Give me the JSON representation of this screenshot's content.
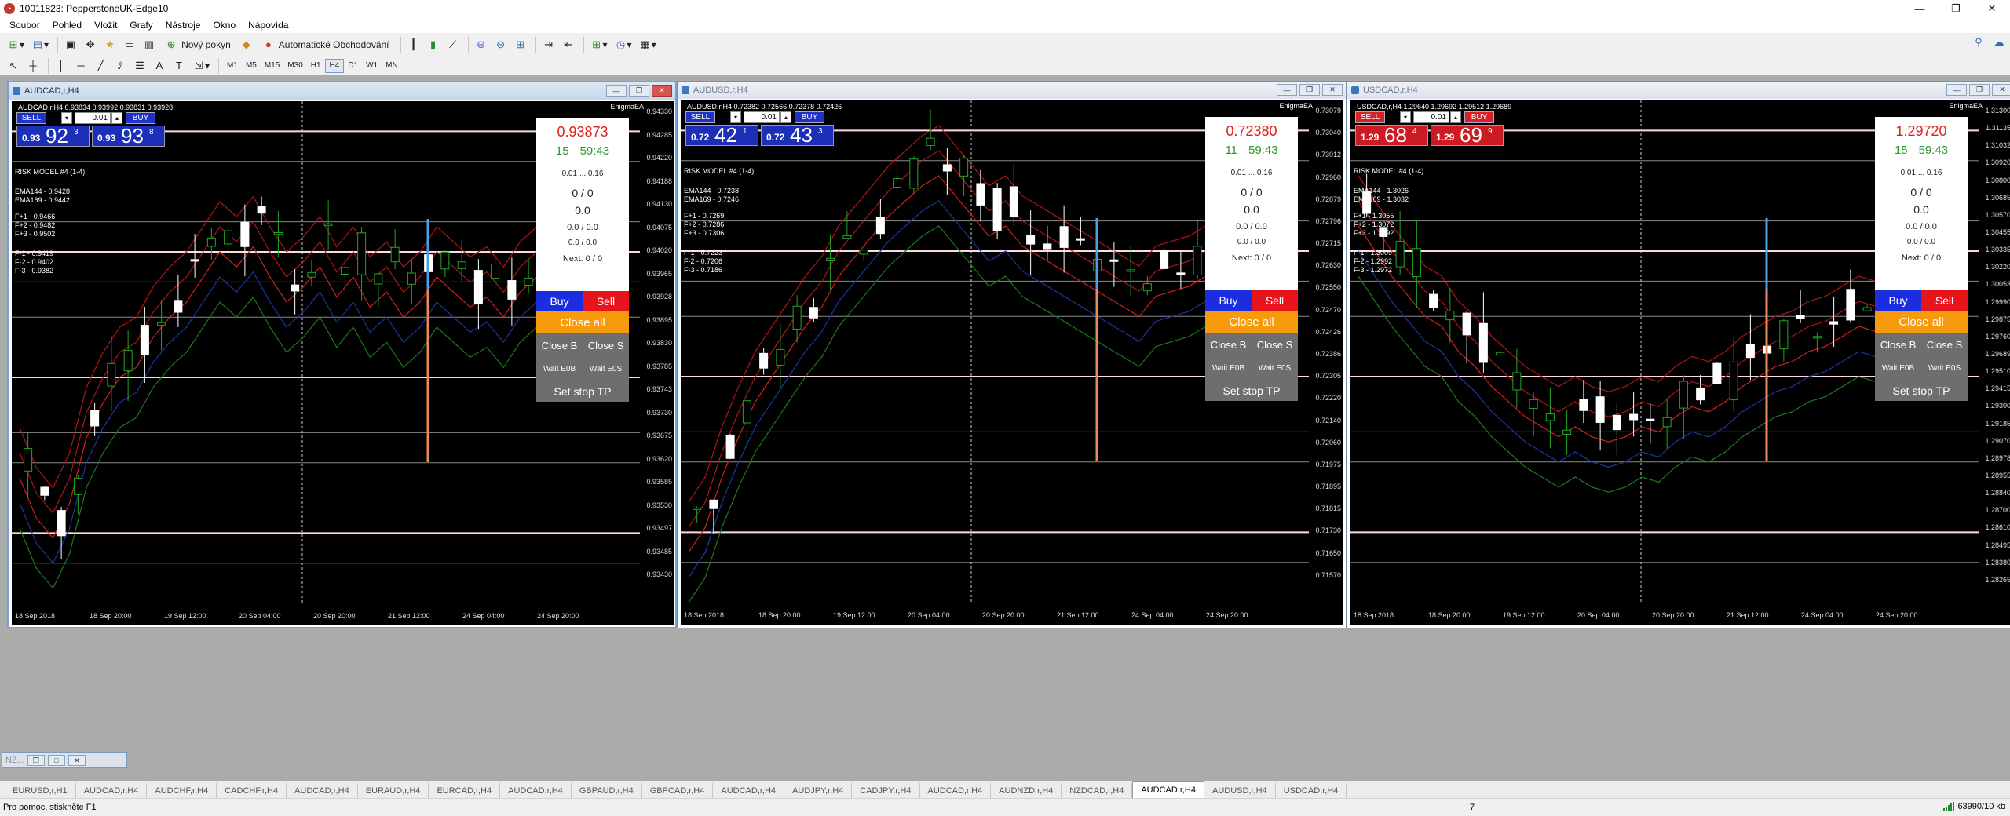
{
  "app": {
    "title": "10011823: PepperstoneUK-Edge10"
  },
  "menu": [
    "Soubor",
    "Pohled",
    "Vložit",
    "Grafy",
    "Nástroje",
    "Okno",
    "Nápovìda"
  ],
  "toolbar": {
    "new_order_label": "Nový pokyn",
    "autotrading_label": "Automatické Obchodování",
    "timeframes": [
      "M1",
      "M5",
      "M15",
      "M30",
      "H1",
      "H4",
      "D1",
      "W1",
      "MN"
    ],
    "active_timeframe": "H4"
  },
  "charts": [
    {
      "window_title": "AUDCAD,r,H4",
      "ohlc_line": "AUDCAD,r,H4  0.93834 0.93992 0.93831 0.93928",
      "ea_label": "EnigmaEA",
      "lot": "0.01",
      "sell_label": "SELL",
      "buy_label": "BUY",
      "sell_quote": {
        "small": "0.93",
        "big": "92",
        "sup": "3"
      },
      "buy_quote": {
        "small": "0.93",
        "big": "93",
        "sup": "8"
      },
      "theme": "blue",
      "risk_model": "RISK MODEL #4 (1-4)",
      "ema_lines": [
        "EMA144 - 0.9428",
        "EMA169 - 0.9442"
      ],
      "fplus_lines": [
        "F+1 - 0.9466",
        "F+2 - 0.9482",
        "F+3 - 0.9502"
      ],
      "fminus_lines": [
        "F-1 - 0.9419",
        "F-2 - 0.9402",
        "F-3 - 0.9382"
      ],
      "panel": {
        "price": "0.93873",
        "timer_a": "15",
        "timer_b": "59:43",
        "range": "0.01 ... 0.16",
        "r1": "0 / 0",
        "r2": "0.0",
        "r3": "0.0 / 0.0",
        "r4": "0.0 / 0.0",
        "next": "Next: 0 / 0"
      },
      "axis_labels": [
        "0.94330",
        "0.94285",
        "0.94220",
        "0.94188",
        "0.94130",
        "0.94075",
        "0.94020",
        "0.93965",
        "0.93928",
        "0.93895",
        "0.93830",
        "0.93785",
        "0.93743",
        "0.93730",
        "0.93675",
        "0.93620",
        "0.93585",
        "0.93530",
        "0.93497",
        "0.93485",
        "0.93430"
      ],
      "dates": [
        "18 Sep 2018",
        "18 Sep 20:00",
        "19 Sep 12:00",
        "20 Sep 04:00",
        "20 Sep 20:00",
        "21 Sep 12:00",
        "24 Sep 04:00",
        "24 Sep 20:00"
      ]
    },
    {
      "window_title": "AUDUSD,r,H4",
      "ohlc_line": "AUDUSD,r,H4  0.72382 0.72566 0.72378 0.72426",
      "ea_label": "EnigmaEA",
      "lot": "0.01",
      "sell_label": "SELL",
      "buy_label": "BUY",
      "sell_quote": {
        "small": "0.72",
        "big": "42",
        "sup": "1"
      },
      "buy_quote": {
        "small": "0.72",
        "big": "43",
        "sup": "3"
      },
      "theme": "blue",
      "risk_model": "RISK MODEL #4 (1-4)",
      "ema_lines": [
        "EMA144 - 0.7238",
        "EMA169 - 0.7246"
      ],
      "fplus_lines": [
        "F+1 - 0.7269",
        "F+2 - 0.7286",
        "F+3 - 0.7306"
      ],
      "fminus_lines": [
        "F-1 - 0.7223",
        "F-2 - 0.7206",
        "F-3 - 0.7186"
      ],
      "panel": {
        "price": "0.72380",
        "timer_a": "11",
        "timer_b": "59:43",
        "range": "0.01 ... 0.16",
        "r1": "0 / 0",
        "r2": "0.0",
        "r3": "0.0 / 0.0",
        "r4": "0.0 / 0.0",
        "next": "Next: 0 / 0"
      },
      "axis_labels": [
        "0.73079",
        "0.73040",
        "0.73012",
        "0.72960",
        "0.72879",
        "0.72796",
        "0.72715",
        "0.72630",
        "0.72550",
        "0.72470",
        "0.72426",
        "0.72386",
        "0.72305",
        "0.72220",
        "0.72140",
        "0.72060",
        "0.71975",
        "0.71895",
        "0.71815",
        "0.71730",
        "0.71650",
        "0.71570"
      ],
      "dates": [
        "18 Sep 2018",
        "18 Sep 20:00",
        "19 Sep 12:00",
        "20 Sep 04:00",
        "20 Sep 20:00",
        "21 Sep 12:00",
        "24 Sep 04:00",
        "24 Sep 20:00"
      ]
    },
    {
      "window_title": "USDCAD,r,H4",
      "ohlc_line": "USDCAD,r,H4  1.29640 1.29692 1.29512 1.29689",
      "ea_label": "EnigmaEA",
      "lot": "0.01",
      "sell_label": "SELL",
      "buy_label": "BUY",
      "sell_quote": {
        "small": "1.29",
        "big": "68",
        "sup": "4"
      },
      "buy_quote": {
        "small": "1.29",
        "big": "69",
        "sup": "9"
      },
      "theme": "red",
      "risk_model": "RISK MODEL #4 (1-4)",
      "ema_lines": [
        "EMA144 - 1.3026",
        "EMA169 - 1.3032"
      ],
      "fplus_lines": [
        "F+1 - 1.3055",
        "F+2 - 1.3072",
        "F+3 - 1.3092"
      ],
      "fminus_lines": [
        "F-1 - 1.3009",
        "F-2 - 1.2992",
        "F-3 - 1.2972"
      ],
      "panel": {
        "price": "1.29720",
        "timer_a": "15",
        "timer_b": "59:43",
        "range": "0.01 ... 0.16",
        "r1": "0 / 0",
        "r2": "0.0",
        "r3": "0.0 / 0.0",
        "r4": "0.0 / 0.0",
        "next": "Next: 0 / 0"
      },
      "axis_labels": [
        "1.31300",
        "1.31135",
        "1.31032",
        "1.30920",
        "1.30800",
        "1.30685",
        "1.30570",
        "1.30455",
        "1.30335",
        "1.30220",
        "1.30053",
        "1.29990",
        "1.29875",
        "1.29760",
        "1.29689",
        "1.29510",
        "1.29415",
        "1.29300",
        "1.29185",
        "1.29070",
        "1.28978",
        "1.28955",
        "1.28840",
        "1.28700",
        "1.28610",
        "1.28495",
        "1.28380",
        "1.28265"
      ],
      "dates": [
        "18 Sep 2018",
        "18 Sep 20:00",
        "19 Sep 12:00",
        "20 Sep 04:00",
        "20 Sep 20:00",
        "21 Sep 12:00",
        "24 Sep 04:00",
        "24 Sep 20:00"
      ]
    }
  ],
  "panel_buttons": {
    "buy": "Buy",
    "sell": "Sell",
    "close_all": "Close all",
    "close_b": "Close B",
    "close_s": "Close S",
    "wait_eob": "Wait E0B",
    "wait_eos": "Wait E0S",
    "set_stop": "Set stop TP"
  },
  "minimized_window": "NZ...",
  "tabs": [
    "EURUSD,r,H1",
    "AUDCAD,r,H4",
    "AUDCHF,r,H4",
    "CADCHF,r,H4",
    "AUDCAD,r,H4",
    "EURAUD,r,H4",
    "EURCAD,r,H4",
    "AUDCAD,r,H4",
    "GBPAUD,r,H4",
    "GBPCAD,r,H4",
    "AUDCAD,r,H4",
    "AUDJPY,r,H4",
    "CADJPY,r,H4",
    "AUDCAD,r,H4",
    "AUDNZD,r,H4",
    "NZDCAD,r,H4",
    "AUDCAD,r,H4",
    "AUDUSD,r,H4",
    "USDCAD,r,H4"
  ],
  "active_tab_index": 16,
  "status": {
    "help": "Pro pomoc, stiskněte F1",
    "mid": "7",
    "traffic": "63990/10 kb"
  },
  "colors": {
    "candle_bull": "#ffffff",
    "candle_bear": "#22a622",
    "panel_buy": "#1a2ee0",
    "panel_sell": "#e8141c",
    "close_all": "#f79a0c",
    "price_red": "#e0201a"
  }
}
